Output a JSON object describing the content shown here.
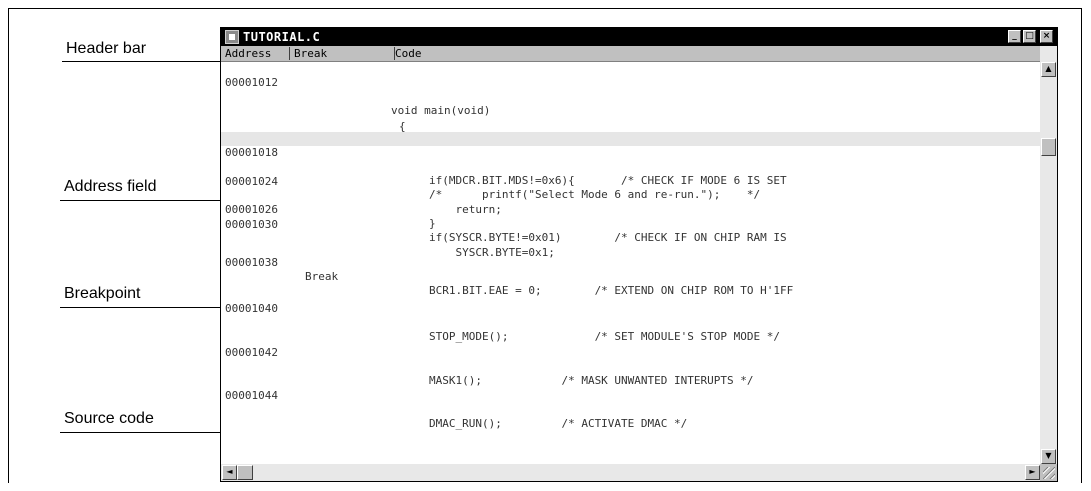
{
  "callouts": {
    "header_bar": "Header bar",
    "address_field": "Address field",
    "breakpoint": "Breakpoint",
    "source_code": "Source code"
  },
  "window": {
    "title": "TUTORIAL.C",
    "buttons": {
      "minimize": "_",
      "maximize": "□",
      "close": "×"
    }
  },
  "columns": {
    "address": "Address",
    "break": "Break",
    "code": "Code"
  },
  "code_lines": [
    {
      "address": "00001012",
      "break": "",
      "code": "void main(void)"
    },
    {
      "address": "",
      "break": "",
      "code": "{"
    },
    {
      "address": "00001018",
      "break": "",
      "code": "if(MDCR.BIT.MDS!=0x6){       /* CHECK IF MODE 6 IS SET"
    },
    {
      "address": "",
      "break": "",
      "code": "/*      printf(\"Select Mode 6 and re-run.\");    */"
    },
    {
      "address": "00001024",
      "break": "",
      "code": "    return;"
    },
    {
      "address": "",
      "break": "",
      "code": "}"
    },
    {
      "address": "00001026",
      "break": "",
      "code": "if(SYSCR.BYTE!=0x01)        /* CHECK IF ON CHIP RAM IS"
    },
    {
      "address": "00001030",
      "break": "",
      "code": "    SYSCR.BYTE=0x1;"
    },
    {
      "address": "00001038",
      "break": "Break",
      "code": "BCR1.BIT.EAE = 0;        /* EXTEND ON CHIP ROM TO H'1FF"
    },
    {
      "address": "00001040",
      "break": "",
      "code": "STOP_MODE();             /* SET MODULE'S STOP MODE */"
    },
    {
      "address": "00001042",
      "break": "",
      "code": "MASK1();            /* MASK UNWANTED INTERUPTS */"
    },
    {
      "address": "00001044",
      "break": "",
      "code": "DMAC_RUN();         /* ACTIVATE DMAC */"
    }
  ],
  "scrollbars": {
    "up": "▲",
    "down": "▼",
    "left": "◄",
    "right": "►"
  }
}
